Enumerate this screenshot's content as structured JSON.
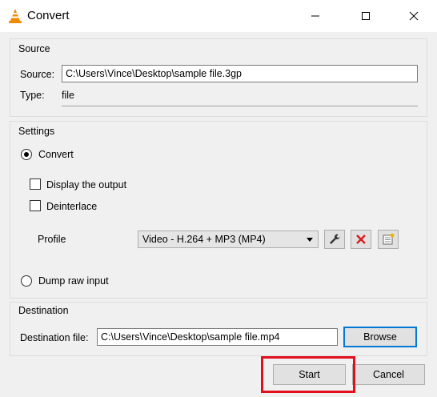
{
  "window": {
    "title": "Convert"
  },
  "source": {
    "legend": "Source",
    "source_label": "Source:",
    "source_value": "C:\\Users\\Vince\\Desktop\\sample file.3gp",
    "type_label": "Type:",
    "type_value": "file"
  },
  "settings": {
    "legend": "Settings",
    "convert_label": "Convert",
    "display_output_label": "Display the output",
    "deinterlace_label": "Deinterlace",
    "profile_label": "Profile",
    "profile_value": "Video - H.264 + MP3 (MP4)",
    "dump_raw_label": "Dump raw input"
  },
  "destination": {
    "legend": "Destination",
    "file_label": "Destination file:",
    "file_value": "C:\\Users\\Vince\\Desktop\\sample file.mp4",
    "browse_label": "Browse"
  },
  "footer": {
    "start_label": "Start",
    "cancel_label": "Cancel"
  },
  "colors": {
    "highlight": "#e2101c",
    "vlc_orange": "#f08a00",
    "delete_red": "#d81e1e",
    "focus_blue": "#0078d7"
  }
}
